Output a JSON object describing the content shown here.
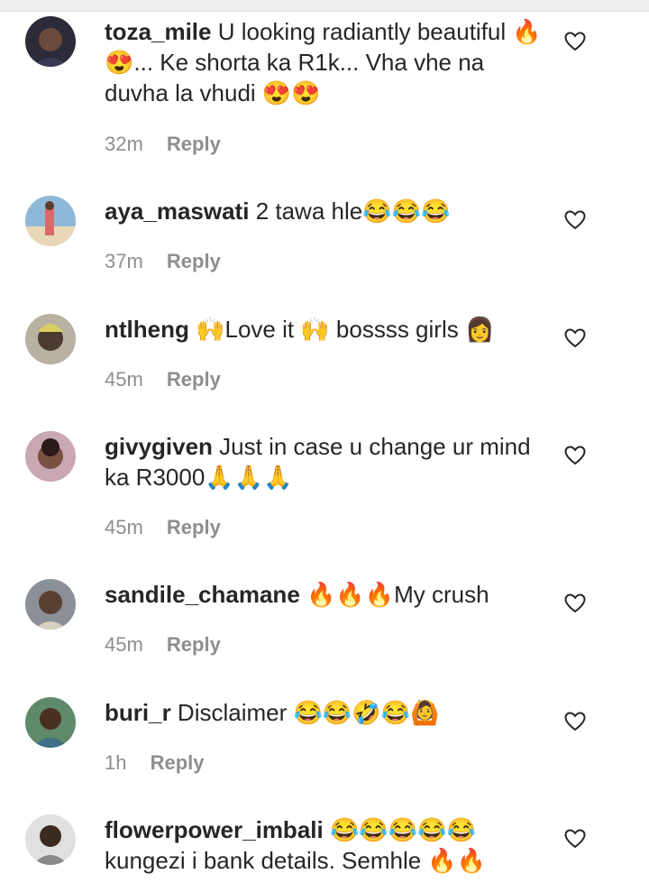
{
  "comments": [
    {
      "username": "toza_mile",
      "text": "U looking radiantly beautiful 🔥😍... Ke shorta ka R1k... Vha vhe na duvha la vhudi 😍😍",
      "time": "32m",
      "reply": "Reply",
      "avatar_color": "#2b2b3a"
    },
    {
      "username": "aya_maswati",
      "text": "2 tawa hle😂😂😂",
      "time": "37m",
      "reply": "Reply",
      "avatar_color": "#8fb8d8"
    },
    {
      "username": "ntlheng",
      "text": "🙌Love it 🙌 bossss girls 👩",
      "time": "45m",
      "reply": "Reply",
      "avatar_color": "#6b6050"
    },
    {
      "username": "givygiven",
      "text": "Just in case u change ur mind ka R3000🙏🙏🙏",
      "time": "45m",
      "reply": "Reply",
      "avatar_color": "#c9a7b4"
    },
    {
      "username": "sandile_chamane",
      "text": "🔥🔥🔥My crush",
      "time": "45m",
      "reply": "Reply",
      "avatar_color": "#8a8f98"
    },
    {
      "username": "buri_r",
      "text": "Disclaimer 😂😂🤣😂🙆",
      "time": "1h",
      "reply": "Reply",
      "avatar_color": "#3e6f87"
    },
    {
      "username": "flowerpower_imbali",
      "text": "😂😂😂😂😂 kungezi i bank details. Semhle 🔥🔥",
      "time": "",
      "reply": "",
      "avatar_color": "#8a8a8a"
    }
  ]
}
